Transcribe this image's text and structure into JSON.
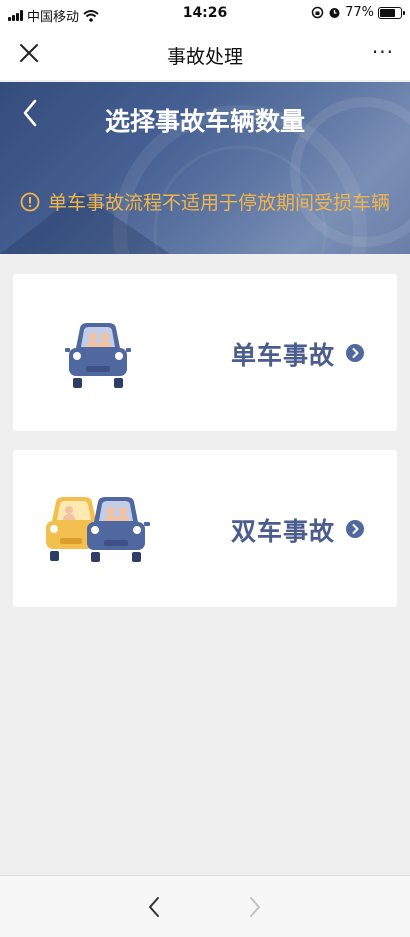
{
  "status_bar": {
    "carrier": "中国移动",
    "time": "14:26",
    "battery": "77%",
    "battery_level": 0.77,
    "icons": [
      "signal-icon",
      "wifi-icon",
      "rotation-lock-icon",
      "alarm-icon",
      "battery-icon"
    ]
  },
  "nav": {
    "title": "事故处理",
    "more": "···",
    "icons": [
      "close-icon",
      "more-icon"
    ]
  },
  "banner": {
    "title": "选择事故车辆数量",
    "notice": "单车事故流程不适用于停放期间受损车辆",
    "notice_color": "#f2b44b",
    "icons": [
      "back-chevron-icon",
      "info-icon"
    ]
  },
  "options": [
    {
      "label": "单车事故",
      "icon": "single-car-icon"
    },
    {
      "label": "双车事故",
      "icon": "two-cars-icon"
    }
  ],
  "colors": {
    "accent": "#4b5c8e",
    "car_blue": "#5068a0",
    "car_yellow": "#f3c050",
    "banner": "#4d6aa0"
  },
  "bottom_bar": {
    "icons": [
      "back-arrow-icon",
      "forward-arrow-icon"
    ]
  }
}
